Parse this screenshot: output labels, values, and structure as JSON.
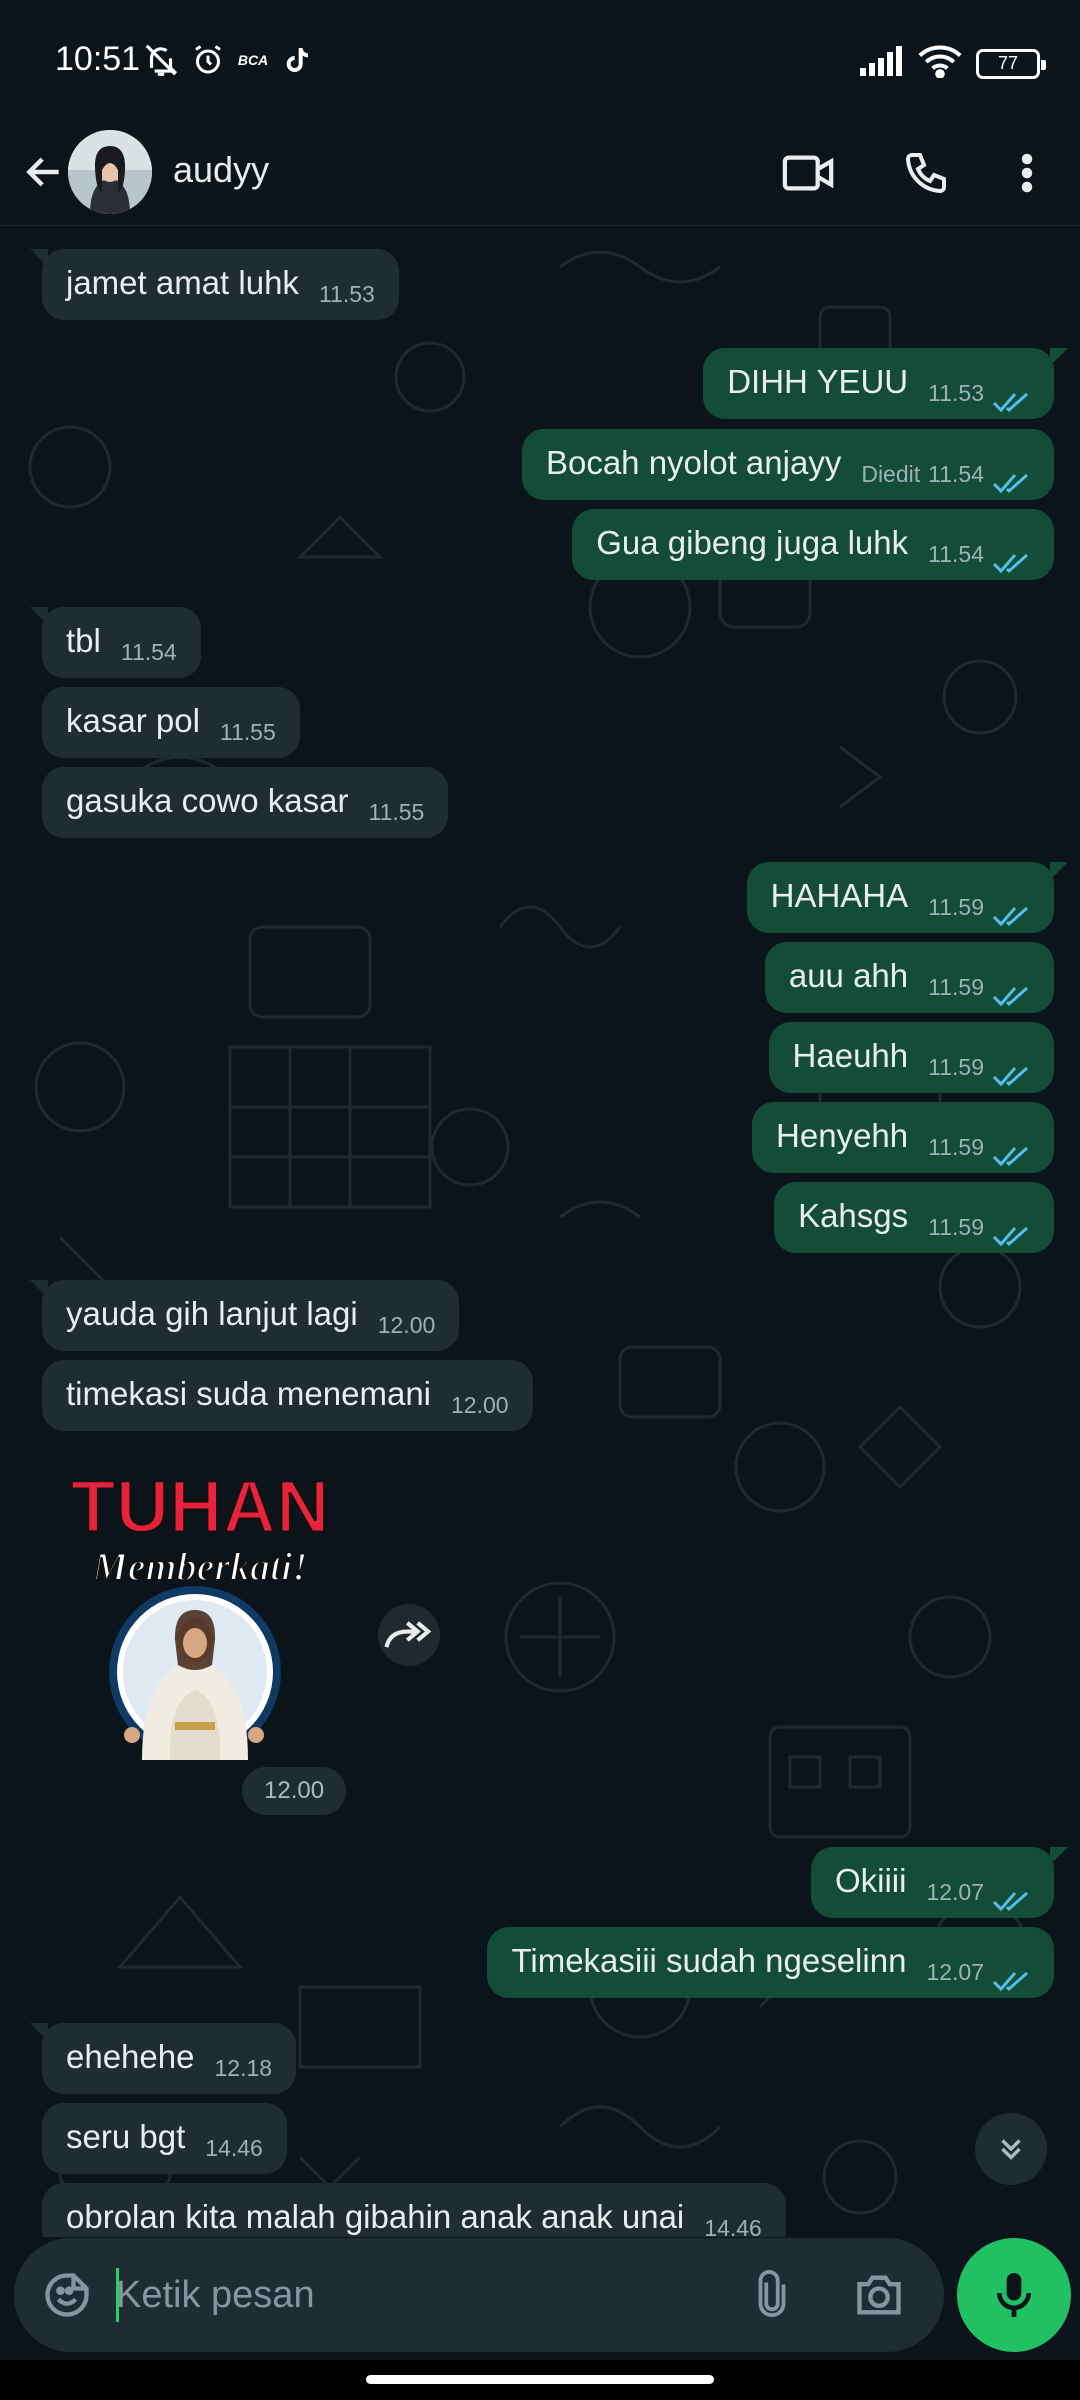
{
  "status_bar": {
    "time": "10:51",
    "battery": "77",
    "app_label": "BCA"
  },
  "header": {
    "contact_name": "audyy"
  },
  "messages": [
    {
      "dir": "in",
      "text": "jamet amat luhk",
      "time": "11.53"
    },
    {
      "dir": "out",
      "text": "DIHH YEUU",
      "time": "11.53",
      "read": true
    },
    {
      "dir": "out",
      "text": "Bocah nyolot anjayy",
      "time": "11.54",
      "edited": "Diedit",
      "read": true
    },
    {
      "dir": "out",
      "text": "Gua gibeng juga luhk",
      "time": "11.54",
      "read": true
    },
    {
      "dir": "in",
      "text": "tbl",
      "time": "11.54"
    },
    {
      "dir": "in",
      "text": "kasar pol",
      "time": "11.55"
    },
    {
      "dir": "in",
      "text": "gasuka cowo kasar",
      "time": "11.55"
    },
    {
      "dir": "out",
      "text": "HAHAHA",
      "time": "11.59",
      "read": true
    },
    {
      "dir": "out",
      "text": "auu ahh",
      "time": "11.59",
      "read": true
    },
    {
      "dir": "out",
      "text": "Haeuhh",
      "time": "11.59",
      "read": true
    },
    {
      "dir": "out",
      "text": "Henyehh",
      "time": "11.59",
      "read": true
    },
    {
      "dir": "out",
      "text": "Kahsgs",
      "time": "11.59",
      "read": true
    },
    {
      "dir": "in",
      "text": "yauda gih lanjut lagi",
      "time": "12.00"
    },
    {
      "dir": "in",
      "text": "timekasi suda menemani",
      "time": "12.00"
    },
    {
      "dir": "out",
      "text": "Okiiii",
      "time": "12.07",
      "read": true
    },
    {
      "dir": "out",
      "text": "Timekasiii sudah ngeselinn",
      "time": "12.07",
      "read": true
    },
    {
      "dir": "in",
      "text": "ehehehe",
      "time": "12.18"
    },
    {
      "dir": "in",
      "text": "seru bgt",
      "time": "14.46"
    },
    {
      "dir": "in",
      "text": "obrolan kita malah gibahin anak anak unai",
      "time": "14.46"
    }
  ],
  "sticker": {
    "line1": "TUHAN",
    "line2": "Memberkati!",
    "time": "12.00"
  },
  "composer": {
    "placeholder": "Ketik pesan"
  },
  "icons": {
    "back": "arrow-left-icon",
    "video": "video-camera-icon",
    "call": "phone-icon",
    "menu": "more-vertical-icon",
    "emoji": "sticker-icon",
    "attach": "paperclip-icon",
    "camera": "camera-icon",
    "mic": "microphone-icon",
    "forward": "forward-icon",
    "scroll": "double-chevron-down-icon",
    "read_receipt": "double-check-icon"
  },
  "colors": {
    "background": "#0b141a",
    "incoming_bubble": "#202c33",
    "outgoing_bubble": "#134d37",
    "read_tick": "#53bdeb",
    "accent": "#21c063"
  }
}
